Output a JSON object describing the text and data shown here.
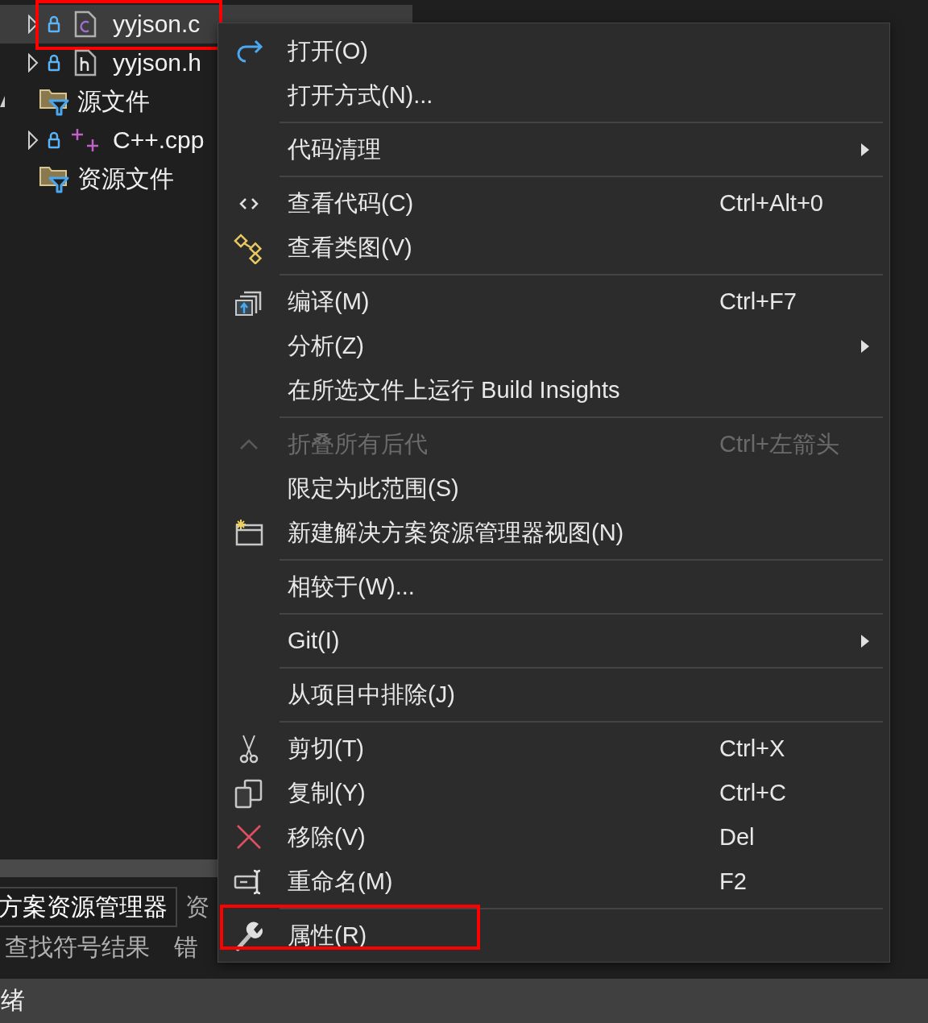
{
  "tree": [
    {
      "label": "yyjson.c",
      "kind": "c-file",
      "expanded": false,
      "locked": true,
      "selected": true,
      "highlighted": true
    },
    {
      "label": "yyjson.h",
      "kind": "h-file",
      "expanded": false,
      "locked": true,
      "selected": false,
      "highlighted": false
    },
    {
      "label": "源文件",
      "kind": "folder",
      "expanded": true,
      "locked": false,
      "selected": false,
      "highlighted": false
    },
    {
      "label": "C++.cpp",
      "kind": "cpp-file",
      "expanded": false,
      "locked": true,
      "selected": false,
      "highlighted": false
    },
    {
      "label": "资源文件",
      "kind": "empty-folder",
      "locked": false,
      "selected": false,
      "highlighted": false
    }
  ],
  "tool_tabs": [
    {
      "label": "方案资源管理器",
      "selected": true
    },
    {
      "label": "资",
      "selected": false
    }
  ],
  "output_tabs": [
    {
      "label": "查找符号结果"
    },
    {
      "label": "错"
    }
  ],
  "context_menu": {
    "groups": [
      [
        {
          "kind": "redo",
          "label": "打开(O)",
          "submenu": false,
          "disabled": false,
          "highlighted": false
        },
        {
          "kind": "plain",
          "label": "打开方式(N)...",
          "submenu": false,
          "disabled": false,
          "highlighted": false
        }
      ],
      [
        {
          "kind": "plain",
          "label": "代码清理",
          "submenu": true,
          "disabled": false,
          "highlighted": false
        }
      ],
      [
        {
          "kind": "code",
          "label": "查看代码(C)",
          "shortcut": "Ctrl+Alt+0",
          "submenu": false,
          "disabled": false,
          "highlighted": false
        },
        {
          "kind": "class-diagram",
          "label": "查看类图(V)",
          "submenu": false,
          "disabled": false,
          "highlighted": false
        }
      ],
      [
        {
          "kind": "build",
          "label": "编译(M)",
          "shortcut": "Ctrl+F7",
          "submenu": false,
          "disabled": false,
          "highlighted": false
        },
        {
          "kind": "plain",
          "label": "分析(Z)",
          "submenu": true,
          "disabled": false,
          "highlighted": false
        },
        {
          "kind": "plain",
          "label": "在所选文件上运行 Build Insights",
          "submenu": false,
          "disabled": false,
          "highlighted": false
        }
      ],
      [
        {
          "kind": "collapse",
          "label": "折叠所有后代",
          "shortcut": "Ctrl+左箭头",
          "submenu": false,
          "disabled": true,
          "highlighted": false
        },
        {
          "kind": "plain",
          "label": "限定为此范围(S)",
          "submenu": false,
          "disabled": false,
          "highlighted": false
        },
        {
          "kind": "new-view",
          "label": "新建解决方案资源管理器视图(N)",
          "submenu": false,
          "disabled": false,
          "highlighted": false
        }
      ],
      [
        {
          "kind": "plain",
          "label": "相较于(W)...",
          "submenu": false,
          "disabled": false,
          "highlighted": false
        }
      ],
      [
        {
          "kind": "plain",
          "label": "Git(I)",
          "submenu": true,
          "disabled": false,
          "highlighted": false
        }
      ],
      [
        {
          "kind": "plain",
          "label": "从项目中排除(J)",
          "submenu": false,
          "disabled": false,
          "highlighted": false
        }
      ],
      [
        {
          "kind": "scissors",
          "label": "剪切(T)",
          "shortcut": "Ctrl+X",
          "submenu": false,
          "disabled": false,
          "highlighted": false
        },
        {
          "kind": "copy",
          "label": "复制(Y)",
          "shortcut": "Ctrl+C",
          "submenu": false,
          "disabled": false,
          "highlighted": false
        },
        {
          "kind": "delete",
          "label": "移除(V)",
          "shortcut": "Del",
          "submenu": false,
          "disabled": false,
          "highlighted": false
        },
        {
          "kind": "rename",
          "label": "重命名(M)",
          "shortcut": "F2",
          "submenu": false,
          "disabled": false,
          "highlighted": false
        }
      ],
      [
        {
          "kind": "wrench",
          "label": "属性(R)",
          "submenu": false,
          "disabled": false,
          "highlighted": true
        }
      ]
    ]
  },
  "status_bar": {
    "text": "绪"
  }
}
